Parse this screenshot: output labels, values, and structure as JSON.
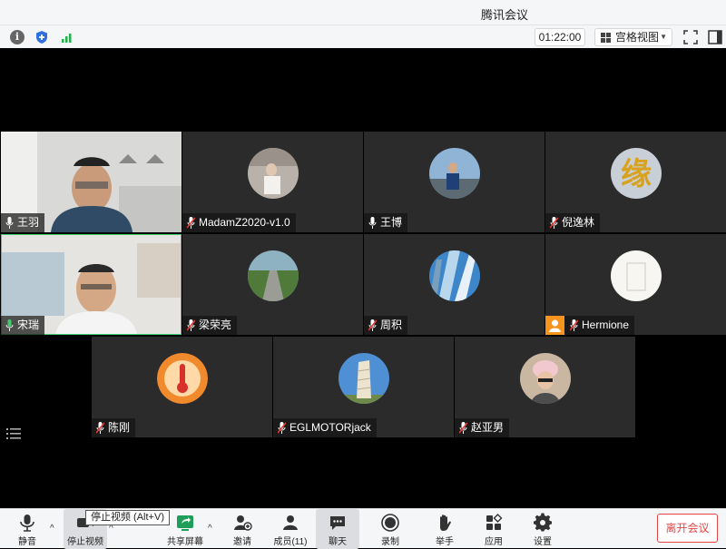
{
  "window": {
    "title": "腾讯会议"
  },
  "infobar": {
    "timer": "01:22:00",
    "view_mode": "宫格视图"
  },
  "participants": [
    {
      "name": "王羽",
      "video": true
    },
    {
      "name": "MadamZ2020-v1.0",
      "video": false,
      "muted": true
    },
    {
      "name": "王博",
      "video": false
    },
    {
      "name": "倪逸林",
      "video": false,
      "muted": true
    },
    {
      "name": "宋瑞",
      "video": true,
      "speaking": true
    },
    {
      "name": "梁荣亮",
      "video": false,
      "muted": true
    },
    {
      "name": "周积",
      "video": false,
      "muted": true
    },
    {
      "name": "Hermione",
      "video": false,
      "muted": true
    },
    {
      "name": "陈刚",
      "video": false,
      "muted": true
    },
    {
      "name": "EGLMOTORjack",
      "video": false,
      "muted": true
    },
    {
      "name": "赵亚男",
      "video": false,
      "muted": true
    }
  ],
  "toolbar": {
    "mute": "静音",
    "stop_video": "停止视频",
    "stop_video_tooltip": "停止视频 (Alt+V)",
    "share_screen": "共享屏幕",
    "invite": "邀请",
    "members": "成员(11)",
    "chat": "聊天",
    "record": "录制",
    "raise_hand": "举手",
    "apps": "应用",
    "settings": "设置",
    "leave": "离开会议"
  },
  "colors": {
    "accent_green": "#3ecf6f",
    "leave_red": "#e54545",
    "badge_orange": "#f7941d"
  }
}
